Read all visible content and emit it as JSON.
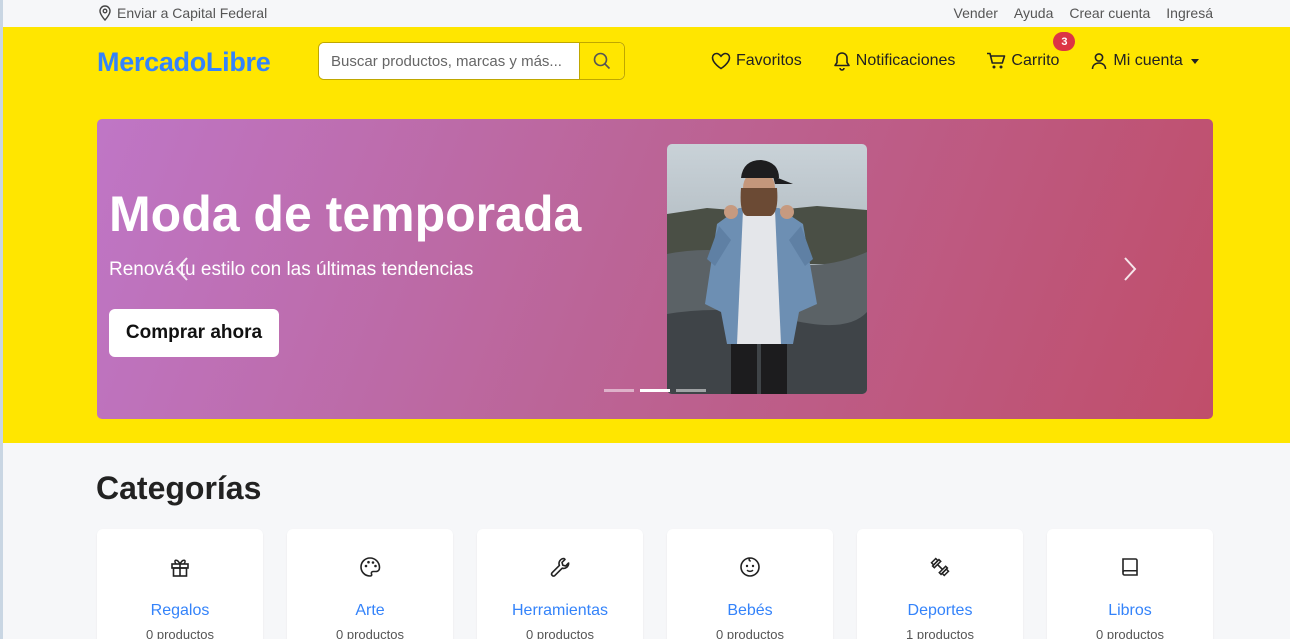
{
  "topbar": {
    "location": "Enviar a Capital Federal",
    "links": [
      "Vender",
      "Ayuda",
      "Crear cuenta",
      "Ingresá"
    ]
  },
  "header": {
    "logo": "MercadoLibre",
    "search_placeholder": "Buscar productos, marcas y más...",
    "nav": {
      "favorites": "Favoritos",
      "notifications": "Notificaciones",
      "cart": "Carrito",
      "cart_count": "3",
      "account": "Mi cuenta"
    }
  },
  "carousel": {
    "title": "Moda de temporada",
    "subtitle": "Renová tu estilo con las últimas tendencias",
    "cta": "Comprar ahora",
    "active_index": 1,
    "slide_count": 3
  },
  "categories": {
    "title": "Categorías",
    "items": [
      {
        "name": "Regalos",
        "count": "0 productos",
        "icon": "gift-icon"
      },
      {
        "name": "Arte",
        "count": "0 productos",
        "icon": "palette-icon"
      },
      {
        "name": "Herramientas",
        "count": "0 productos",
        "icon": "wrench-icon"
      },
      {
        "name": "Bebés",
        "count": "0 productos",
        "icon": "baby-icon"
      },
      {
        "name": "Deportes",
        "count": "1 productos",
        "icon": "dumbbell-icon"
      },
      {
        "name": "Libros",
        "count": "0 productos",
        "icon": "book-icon"
      }
    ]
  },
  "colors": {
    "header_bg": "#ffe600",
    "brand_blue": "#3483fa",
    "badge_red": "#dc3545"
  }
}
